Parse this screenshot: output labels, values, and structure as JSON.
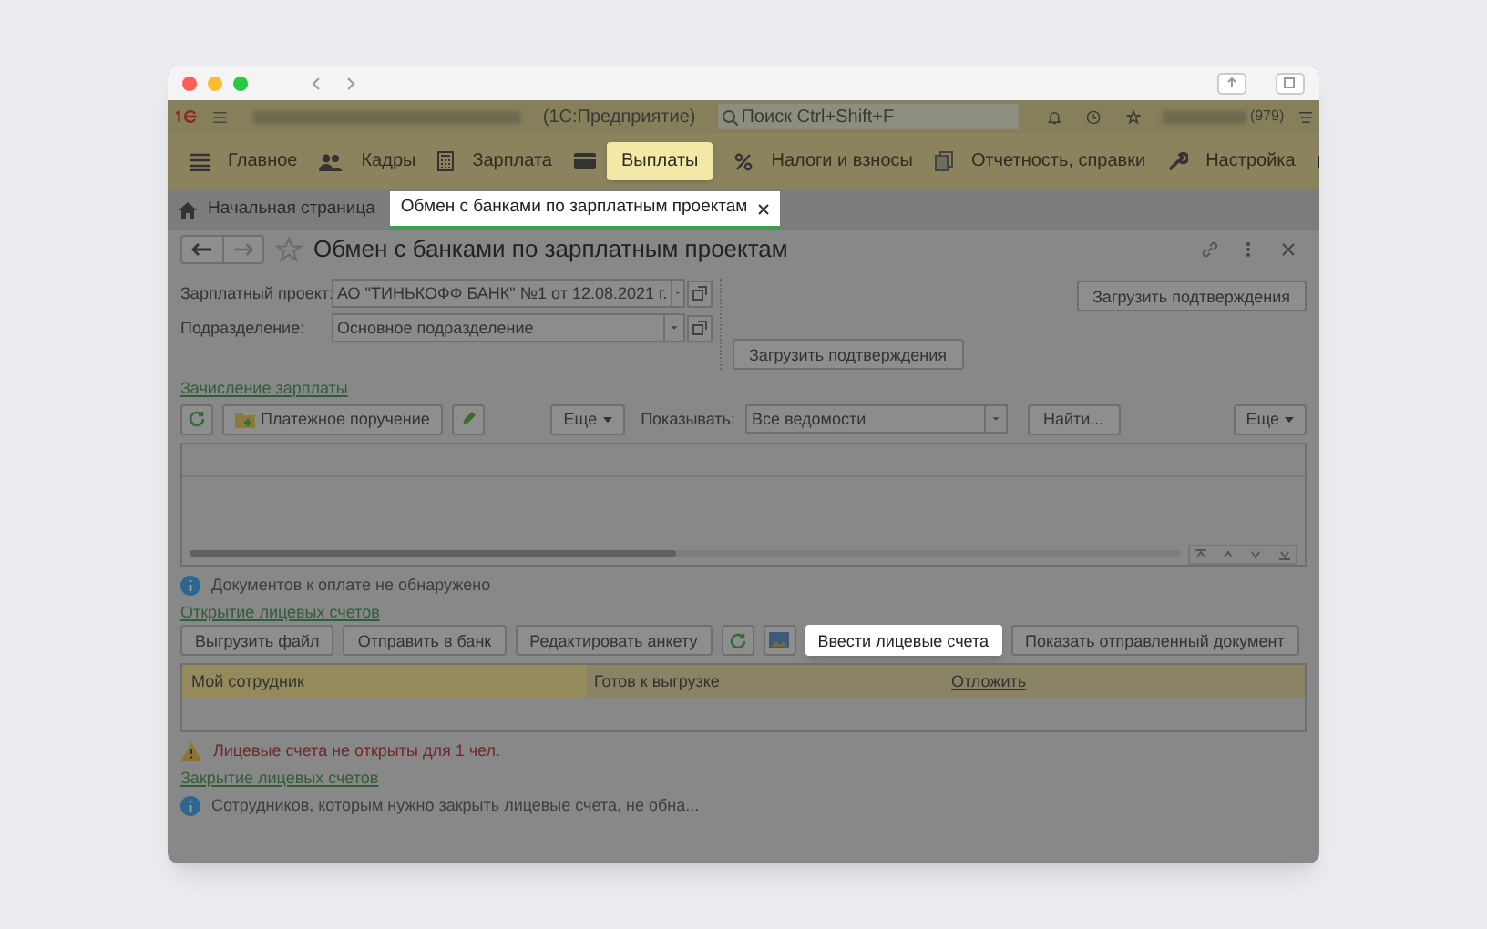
{
  "window": {
    "title": "(1С:Предприятие)",
    "search": {
      "placeholder": "Поиск Ctrl+Shift+F"
    },
    "counter": "(979)"
  },
  "sections": [
    {
      "label": "Главное",
      "kind": "menu",
      "selected": false
    },
    {
      "label": "Кадры",
      "kind": "people",
      "selected": false
    },
    {
      "label": "Зарплата",
      "kind": "calculator",
      "selected": false
    },
    {
      "label": "Выплаты",
      "kind": "card",
      "selected": true
    },
    {
      "label": "Налоги и взносы",
      "kind": "percent",
      "selected": false
    },
    {
      "label": "Отчетность, справки",
      "kind": "docs",
      "selected": false
    },
    {
      "label": "Настройка",
      "kind": "wrench",
      "selected": false
    }
  ],
  "tabs": [
    {
      "label": "Начальная страница",
      "kind": "home",
      "selected": false
    },
    {
      "label": "Обмен с банками по зарплатным проектам",
      "kind": "document",
      "selected": true
    }
  ],
  "form": {
    "title": "Обмен с банками по зарплатным проектам",
    "fields": [
      {
        "label": "Зарплатный проект:",
        "value": "АО \"ТИНЬКОФФ БАНК\" №1 от 12.08.2021 г."
      },
      {
        "label": "Подразделение:",
        "value": "Основное подразделение"
      }
    ],
    "load_buttons": [
      "Загрузить подтверждения",
      "Загрузить подтверждения"
    ]
  },
  "payroll": {
    "link": "Зачисление зарплаты",
    "pay_order": "Платежное поручение",
    "more": [
      "Еще",
      "Еще"
    ],
    "show_label": "Показывать:",
    "show_value": "Все ведомости",
    "find": "Найти...",
    "info": "Документов к оплате не обнаружено"
  },
  "opening": {
    "link": "Открытие лицевых счетов",
    "buttons": [
      {
        "label": "Выгрузить файл",
        "kind": "text",
        "highlighted": false
      },
      {
        "label": "Отправить в банк",
        "kind": "text",
        "highlighted": false
      },
      {
        "label": "Редактировать анкету",
        "kind": "text",
        "highlighted": false
      },
      {
        "kind": "refresh",
        "highlighted": false
      },
      {
        "kind": "image",
        "highlighted": false
      },
      {
        "label": "Ввести лицевые счета",
        "kind": "text",
        "highlighted": true
      },
      {
        "label": "Показать отправленный документ",
        "kind": "text",
        "highlighted": false
      }
    ],
    "columns": [
      {
        "label": "Мой сотрудник",
        "kind": "current"
      },
      {
        "label": "Готов к выгрузке",
        "kind": "plain"
      },
      {
        "label": "Отложить",
        "kind": "link"
      }
    ],
    "warning": "Лицевые счета не открыты для 1 чел."
  },
  "closing": {
    "link": "Закрытие лицевых счетов",
    "info": "Сотрудников, которым нужно закрыть лицевые счета, не обна..."
  }
}
